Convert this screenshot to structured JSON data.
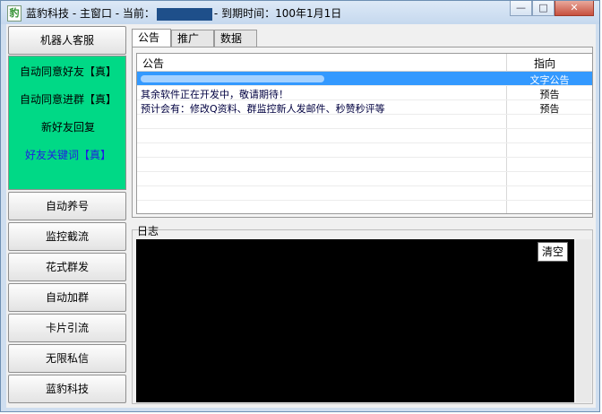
{
  "title_bar": {
    "title_prefix": "蓝豹科技 - 主窗口 - 当前：",
    "title_suffix": "- 到期时间：100年1月1日",
    "minimize": "—",
    "maximize": "□",
    "close": "✕"
  },
  "sidebar": {
    "robot_service": "机器人客服",
    "green_items": [
      "自动同意好友【真】",
      "自动同意进群【真】",
      "新好友回复",
      "好友关键词【真】"
    ],
    "buttons": [
      "自动养号",
      "监控截流",
      "花式群发",
      "自动加群",
      "卡片引流",
      "无限私信",
      "蓝豹科技"
    ]
  },
  "tabs": [
    "公告",
    "推广",
    "数据"
  ],
  "notice_table": {
    "headers": [
      "公告",
      "指向"
    ],
    "rows": [
      {
        "text": "",
        "target": "文字公告",
        "selected": true
      },
      {
        "text": "其余软件正在开发中，敬请期待！",
        "target": "预告",
        "selected": false
      },
      {
        "text": "预计会有：修改Q资料、群监控新人发邮件、秒赞秒评等",
        "target": "预告",
        "selected": false
      }
    ]
  },
  "log": {
    "label": "日志",
    "clear_button": "清空"
  }
}
